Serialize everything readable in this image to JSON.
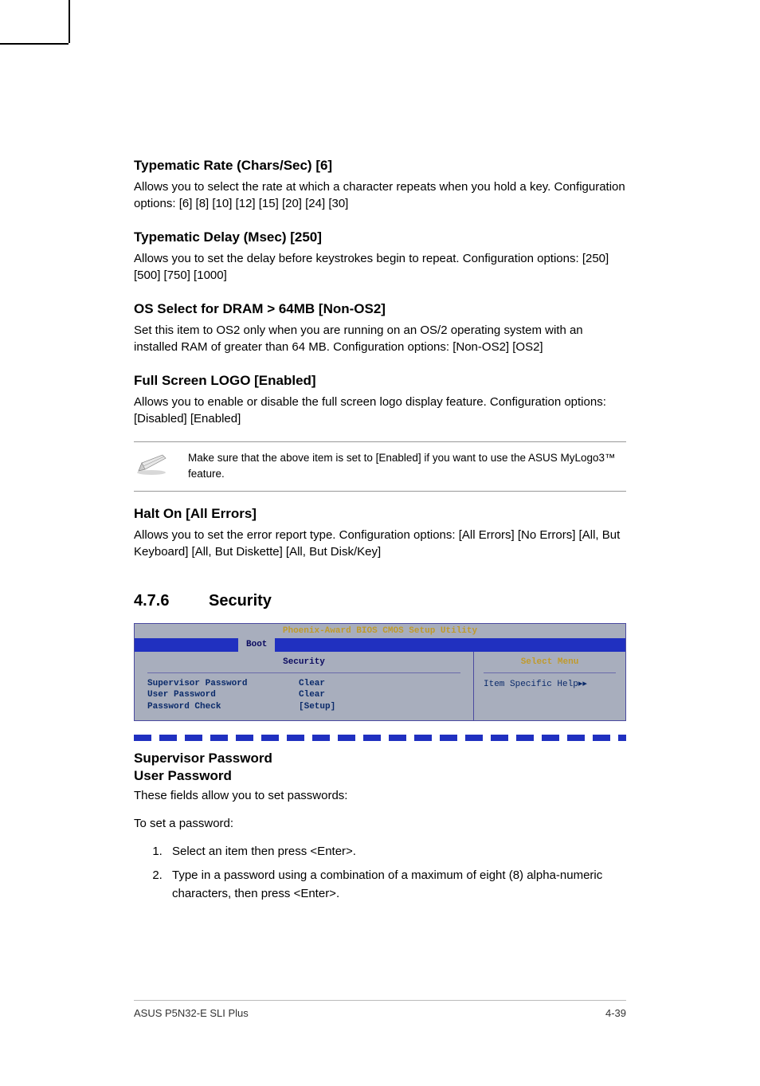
{
  "sections": {
    "typematic_rate": {
      "heading": "Typematic Rate (Chars/Sec) [6]",
      "body": "Allows you to select the rate at which a character repeats when you hold a key. Configuration options: [6] [8] [10] [12] [15] [20] [24] [30]"
    },
    "typematic_delay": {
      "heading": "Typematic Delay (Msec) [250]",
      "body": "Allows you to set the delay before keystrokes begin to repeat. Configuration options: [250] [500] [750] [1000]"
    },
    "os_select": {
      "heading": "OS Select for DRAM > 64MB [Non-OS2]",
      "body": "Set this item to OS2 only when you are running on an OS/2 operating system with an installed RAM of greater than 64 MB. Configuration options: [Non-OS2] [OS2]"
    },
    "full_logo": {
      "heading": "Full Screen LOGO [Enabled]",
      "body": "Allows you to enable or disable the full screen logo display feature. Configuration options: [Disabled] [Enabled]"
    },
    "note": "Make sure that the above item is set to [Enabled] if you want to use the ASUS MyLogo3™ feature.",
    "halt_on": {
      "heading": "Halt On [All Errors]",
      "body": "Allows you to set the error report type. Configuration options: [All Errors] [No Errors] [All, But Keyboard] [All, But Diskette] [All, But Disk/Key]"
    }
  },
  "security_section": {
    "number": "4.7.6",
    "title": "Security"
  },
  "bios": {
    "title": "Phoenix-Award BIOS CMOS Setup Utility",
    "tab": "Boot",
    "subhead": "Security",
    "right_head": "Select Menu",
    "right_body": "Item Specific Help",
    "rows": [
      {
        "label": "Supervisor Password",
        "value": "Clear"
      },
      {
        "label": "User Password",
        "value": "Clear"
      },
      {
        "label": "Password Check",
        "value": "[Setup]"
      }
    ]
  },
  "passwords": {
    "heading1": "Supervisor Password",
    "heading2": "User Password",
    "intro": "These fields allow you to set passwords:",
    "intro2": "To set a password:",
    "steps": [
      "Select an item then press <Enter>.",
      "Type in a password using a combination of a maximum of eight (8) alpha-numeric characters, then press <Enter>."
    ]
  },
  "footer": {
    "left": "ASUS P5N32-E SLI Plus",
    "right": "4-39"
  }
}
